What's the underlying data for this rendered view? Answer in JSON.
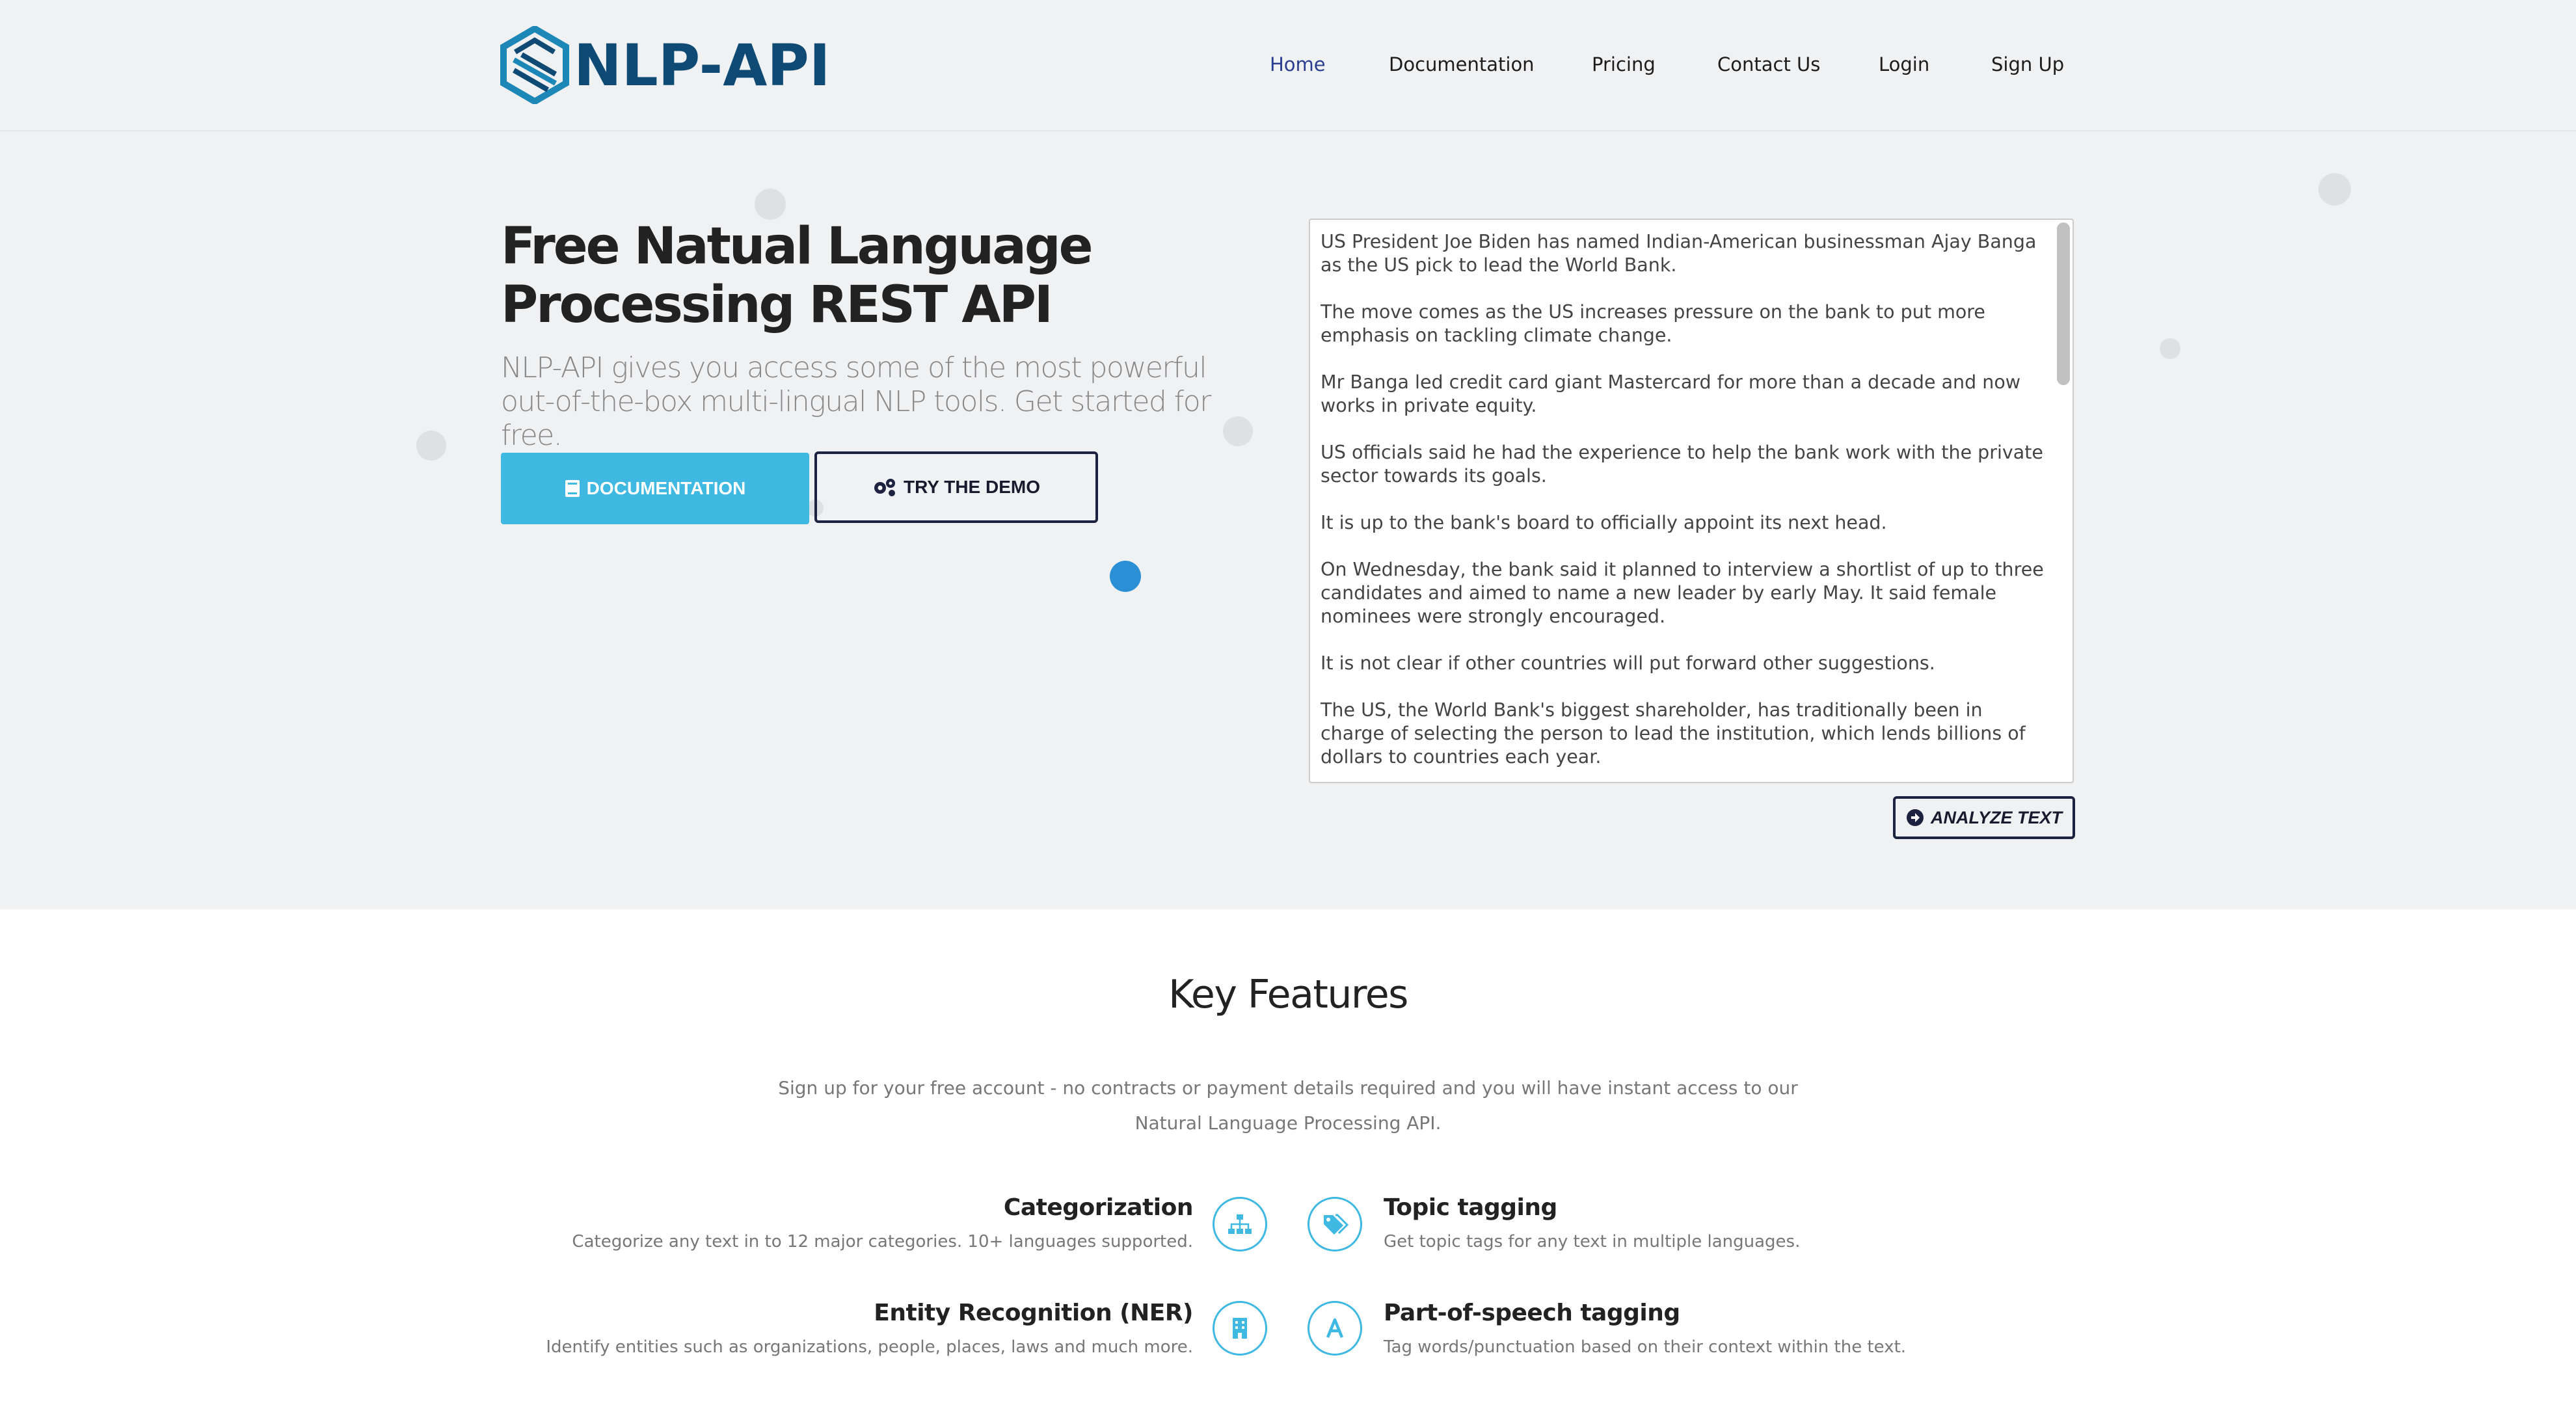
{
  "brand": {
    "name": "NLP-API"
  },
  "nav": {
    "items": [
      {
        "label": "Home",
        "active": true
      },
      {
        "label": "Documentation",
        "active": false
      },
      {
        "label": "Pricing",
        "active": false
      },
      {
        "label": "Contact Us",
        "active": false
      },
      {
        "label": "Login",
        "active": false
      },
      {
        "label": "Sign Up",
        "active": false
      }
    ]
  },
  "hero": {
    "title": "Free Natual Language Processing REST API",
    "subtitle": "NLP-API gives you access some of the most powerful out-of-the-box multi-lingual NLP tools. Get started for free.",
    "doc_button": "DOCUMENTATION",
    "demo_button": "TRY THE DEMO",
    "analyze_button": "ANALYZE TEXT",
    "demo_text": "US President Joe Biden has named Indian-American businessman Ajay Banga as the US pick to lead the World Bank.\n\nThe move comes as the US increases pressure on the bank to put more emphasis on tackling climate change.\n\nMr Banga led credit card giant Mastercard for more than a decade and now works in private equity.\n\nUS officials said he had the experience to help the bank work with the private sector towards its goals.\n\nIt is up to the bank's board to officially appoint its next head.\n\nOn Wednesday, the bank said it planned to interview a shortlist of up to three candidates and aimed to name a new leader by early May. It said female nominees were strongly encouraged.\n\nIt is not clear if other countries will put forward other suggestions.\n\nThe US, the World Bank's biggest shareholder, has traditionally been in charge of selecting the person to lead the institution, which lends billions of dollars to countries each year."
  },
  "features": {
    "title": "Key Features",
    "subtitle_line1": "Sign up for your free account - no contracts or payment details required and you will have instant access to our",
    "subtitle_line2": "Natural Language Processing API.",
    "items": [
      {
        "title": "Categorization",
        "desc": "Categorize any text in to 12 major categories. 10+ languages supported.",
        "icon": "sitemap-icon"
      },
      {
        "title": "Topic tagging",
        "desc": "Get topic tags for any text in multiple languages.",
        "icon": "tags-icon"
      },
      {
        "title": "Entity Recognition (NER)",
        "desc": "Identify entities such as organizations, people, places, laws and much more.",
        "icon": "building-icon"
      },
      {
        "title": "Part-of-speech tagging",
        "desc": "Tag words/punctuation based on their context within the text.",
        "icon": "letter-a-icon"
      }
    ]
  },
  "colors": {
    "accent": "#3fb8e2",
    "brand": "#0f4a74",
    "nav_active": "#2a3e8f",
    "dark_border": "#1c2240"
  }
}
